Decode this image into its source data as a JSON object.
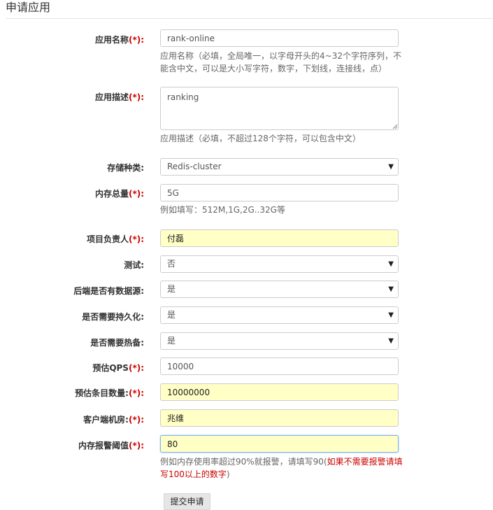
{
  "page": {
    "title": "申请应用"
  },
  "required_mark": "(*):",
  "fields": {
    "app_name": {
      "label": "应用名称",
      "value": "rank-online",
      "help": "应用名称（必填，全局唯一，以字母开头的4~32个字符序列，不能含中文，可以是大小写字符，数字，下划线，连接线，点）"
    },
    "app_desc": {
      "label": "应用描述",
      "value": "ranking",
      "help": "应用描述（必填，不超过128个字符，可以包含中文）"
    },
    "storage_type": {
      "label": "存储种类:",
      "value": "Redis-cluster"
    },
    "memory_total": {
      "label": "内存总量",
      "value": "5G",
      "help": "例如填写：512M,1G,2G..32G等"
    },
    "owner": {
      "label": "项目负责人",
      "value": "付磊"
    },
    "test": {
      "label": "测试:",
      "value": "否"
    },
    "backend_source": {
      "label": "后端是否有数据源:",
      "value": "是"
    },
    "persistence": {
      "label": "是否需要持久化:",
      "value": "是"
    },
    "hot_standby": {
      "label": "是否需要热备:",
      "value": "是"
    },
    "qps": {
      "label": "预估QPS",
      "value": "10000"
    },
    "entries": {
      "label": "预估条目数量:",
      "value": "10000000"
    },
    "client_room": {
      "label": "客户端机房:",
      "value": "兆维"
    },
    "mem_alarm": {
      "label": "内存报警阈值",
      "value": "80",
      "help_prefix": "例如内存使用率超过90%就报警，请填写90(",
      "help_warn": "如果不需要报警请填写100以上的数字",
      "help_suffix": ")"
    }
  },
  "submit_label": "提交申请",
  "icons": {
    "caret": "caret-down-icon"
  }
}
